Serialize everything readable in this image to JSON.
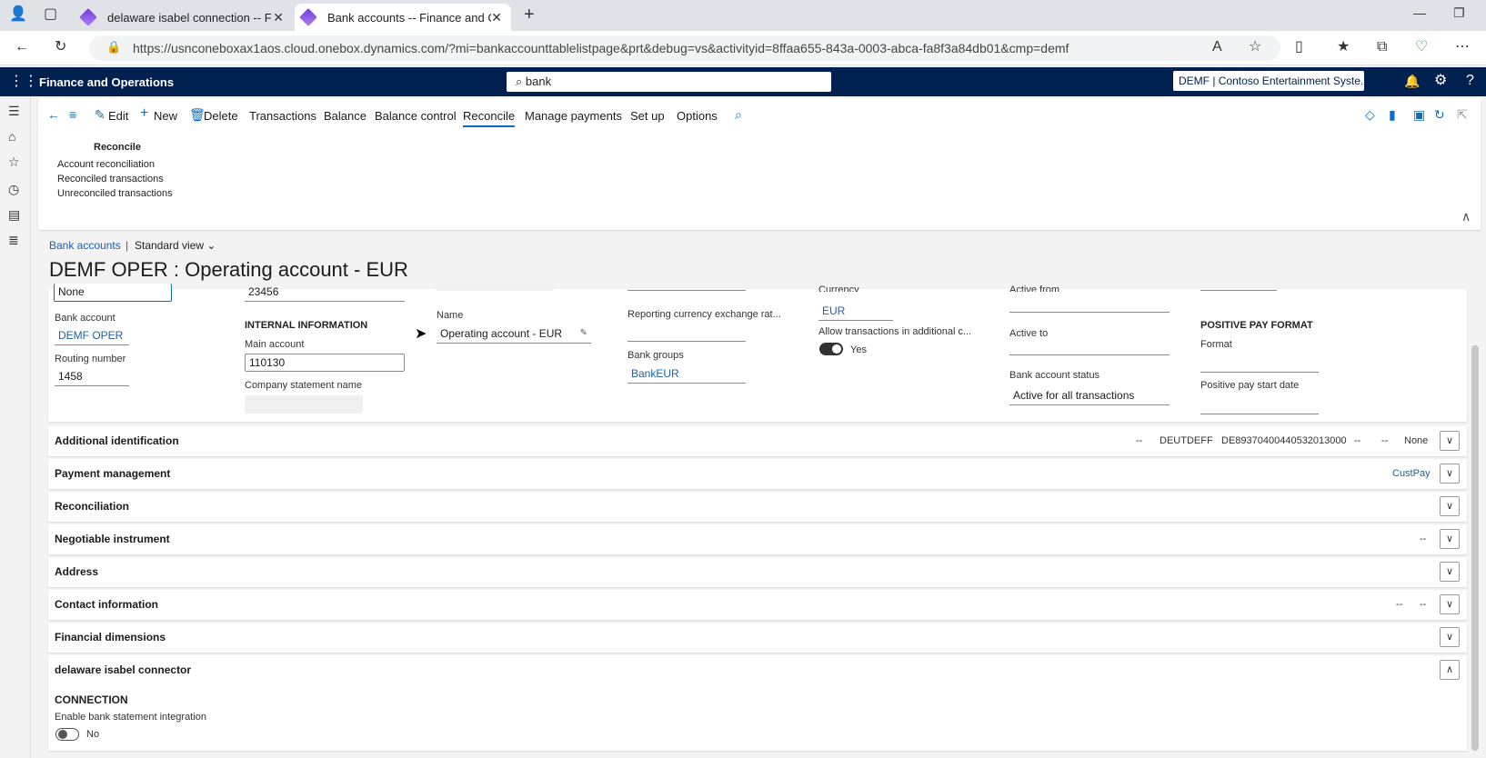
{
  "browser": {
    "tabs": [
      {
        "title": "delaware isabel connection -- Fin"
      },
      {
        "title": "Bank accounts -- Finance and Op"
      }
    ],
    "url": "https://usnconeboxax1aos.cloud.onebox.dynamics.com/?mi=bankaccounttablelistpage&prt&debug=vs&activityid=8ffaa655-843a-0003-abca-fa8f3a84db01&cmp=demf"
  },
  "app": {
    "title": "Finance and Operations",
    "search": "bank",
    "company": "DEMF | Contoso Entertainment Syste..."
  },
  "actionpane": {
    "buttons": [
      "Edit",
      "New",
      "Delete",
      "Transactions",
      "Balance",
      "Balance control",
      "Reconcile",
      "Manage payments",
      "Set up",
      "Options"
    ],
    "group_title": "Reconcile",
    "group_items": [
      "Account reconciliation",
      "Reconciled transactions",
      "Unreconciled transactions"
    ]
  },
  "breadcrumb": {
    "link": "Bank accounts",
    "separator": "|",
    "view": "Standard view"
  },
  "page_title": "DEMF OPER : Operating account - EUR",
  "form": {
    "partial_top_value": "None",
    "bank_account_label": "Bank account",
    "bank_account": "DEMF OPER",
    "routing_label": "Routing number",
    "routing": "1458",
    "partial_col2_value": "23456",
    "internal_info": "INTERNAL INFORMATION",
    "main_account_label": "Main account",
    "main_account": "110130",
    "company_statement_label": "Company statement name",
    "name_label": "Name",
    "name": "Operating account - EUR",
    "reporting_rate_label": "Reporting currency exchange rat...",
    "bank_groups_label": "Bank groups",
    "bank_groups": "BankEUR",
    "currency_label": "Currency",
    "currency": "EUR",
    "allow_tx_label": "Allow transactions in additional c...",
    "allow_tx": "Yes",
    "active_from_label": "Active from",
    "active_to_label": "Active to",
    "status_label": "Bank account status",
    "status": "Active for all transactions",
    "positive_pay": "POSITIVE PAY FORMAT",
    "format_label": "Format",
    "pp_start_label": "Positive pay start date"
  },
  "fasttabs": [
    {
      "title": "Additional identification",
      "summary": [
        "--",
        "DEUTDEFF",
        "DE89370400440532013000",
        "--",
        "--",
        "None"
      ],
      "chev": "∨"
    },
    {
      "title": "Payment management",
      "summary": [
        "CustPay"
      ],
      "chev": "∨"
    },
    {
      "title": "Reconciliation",
      "summary": [],
      "chev": "∨"
    },
    {
      "title": "Negotiable instrument",
      "summary": [
        "--"
      ],
      "chev": "∨"
    },
    {
      "title": "Address",
      "summary": [],
      "chev": "∨"
    },
    {
      "title": "Contact information",
      "summary": [
        "--",
        "--"
      ],
      "chev": "∨"
    },
    {
      "title": "Financial dimensions",
      "summary": [],
      "chev": "∨"
    },
    {
      "title": "delaware isabel connector",
      "summary": [],
      "chev": "∧"
    }
  ],
  "connector": {
    "heading": "CONNECTION",
    "enable_label": "Enable bank statement integration",
    "enable_value": "No"
  }
}
